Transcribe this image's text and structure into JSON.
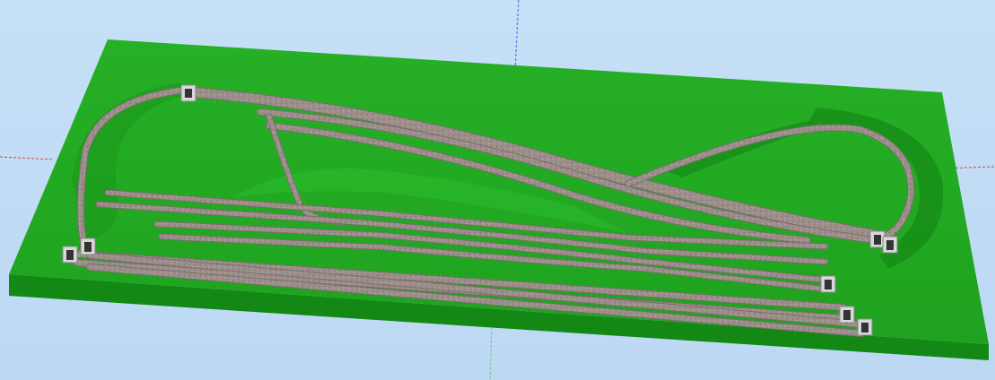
{
  "viewport": {
    "background_color": "#c3ddf5",
    "baseboard_color": "#22a822",
    "baseboard_edge_color": "#1a8e1a",
    "track_ballast_color": "#9a8c88",
    "track_rail_color": "#6e6666",
    "tunnel_portal_color": "#d8d8d8",
    "axis_colors": {
      "x": "#e04040",
      "y": "#40c040",
      "z": "#4060e0"
    },
    "icons": {
      "tunnel_portal": "tunnel-portal-icon"
    }
  }
}
